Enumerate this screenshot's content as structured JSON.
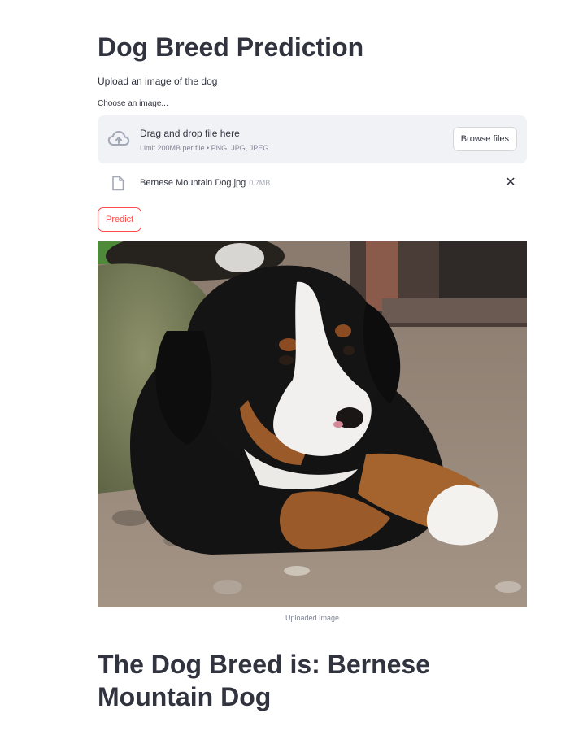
{
  "app": {
    "title": "Dog Breed Prediction",
    "subtitle": "Upload an image of the dog"
  },
  "uploader": {
    "label": "Choose an image...",
    "drop_title": "Drag and drop file here",
    "drop_limit": "Limit 200MB per file • PNG, JPG, JPEG",
    "browse_label": "Browse files",
    "file": {
      "name": "Bernese Mountain Dog.jpg",
      "size": "0.7MB",
      "remove_symbol": "✕"
    }
  },
  "predict": {
    "label": "Predict"
  },
  "image": {
    "icon": "dog-photo",
    "caption": "Uploaded Image"
  },
  "result": {
    "text": "The Dog Breed is: Bernese Mountain Dog"
  },
  "colors": {
    "text": "#31333f",
    "accent": "#ff4b4b",
    "dropzone_bg": "#f0f2f6",
    "muted": "#808495"
  }
}
